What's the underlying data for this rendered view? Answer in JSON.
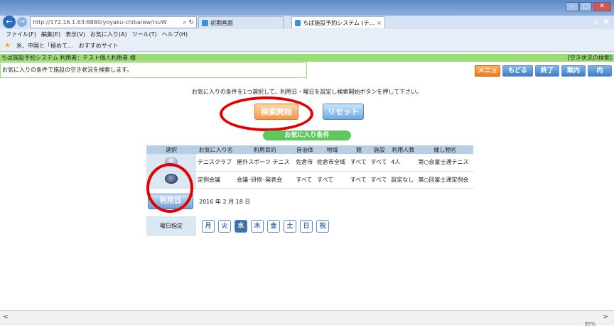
{
  "browser": {
    "url": "http://172.16.1.63:8880/yoyaku-chiba/ew/rsvW",
    "tabs": [
      {
        "title": "初期画面"
      },
      {
        "title": "ちば施設予約システム (テ..."
      }
    ],
    "menu": [
      "ファイル(F)",
      "編集(E)",
      "表示(V)",
      "お気に入り(A)",
      "ツール(T)",
      "ヘルプ(H)"
    ],
    "favorites": [
      "米、中国と「極めて...",
      "おすすめサイト"
    ],
    "zoom": "95%"
  },
  "header": {
    "system_user": "ちば施設予約システム 利用者：テスト個人利用者 様",
    "page_name": "[空き状況の検索]",
    "description": "お気に入りの条件で施設の空き状況を検索します。"
  },
  "top_buttons": {
    "menu": "メニューへ",
    "back": "もどる",
    "end": "終了",
    "help": "案内",
    "info": "内"
  },
  "instruction": "お気に入りの条件を1つ選択して、利用日・曜日を設定し検索開始ボタンを押して下さい。",
  "buttons": {
    "search": "検索開始",
    "reset": "リセット"
  },
  "favorites_title": "お気に入り条件",
  "table": {
    "headers": [
      "選択",
      "お気に入り名",
      "利用目的",
      "自治体",
      "地域",
      "館",
      "施設",
      "利用人数",
      "催し物名"
    ],
    "rows": [
      [
        "",
        "テニスクラブ",
        "屋外スポーツ テニス",
        "佐倉市",
        "佐倉市全域",
        "すべて",
        "すべて",
        "4人",
        "第○会富士通テニス"
      ],
      [
        "",
        "定例会議",
        "会議･研修･発表会",
        "すべて",
        "すべて",
        "すべて",
        "すべて",
        "設定なし",
        "第○回富士通定例会"
      ]
    ]
  },
  "date": {
    "button": "利用日",
    "value": "2016 年 2 月 18 日"
  },
  "weekday": {
    "label": "曜日指定",
    "days": [
      "月",
      "火",
      "水",
      "木",
      "金",
      "土",
      "日",
      "祝"
    ]
  }
}
